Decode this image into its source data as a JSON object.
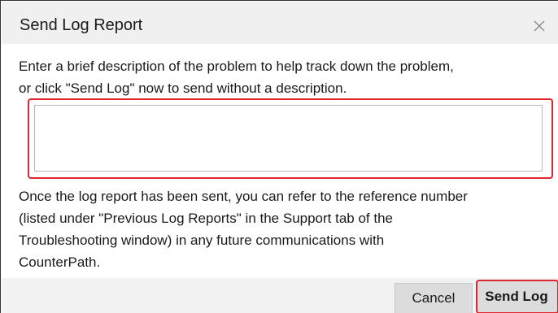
{
  "dialog": {
    "title": "Send Log Report",
    "close_icon": "close-icon",
    "intro_line1": "Enter a brief description of the problem to help track down the problem,",
    "intro_line2": "or click \"Send Log\" now to send without a description.",
    "description_input": {
      "value": "",
      "placeholder": ""
    },
    "info_line1": "Once the log report has been sent, you can refer to the reference number",
    "info_line2": "(listed under \"Previous Log Reports\" in the Support tab of the",
    "info_line3": "Troubleshooting window) in any future communications with",
    "info_line4": "CounterPath.",
    "buttons": {
      "cancel_label": "Cancel",
      "send_label": "Send Log"
    }
  },
  "colors": {
    "highlight": "#e0262e",
    "titlebar_bg": "#f0f0f0",
    "footer_bg": "#f2f2f2",
    "button_bg": "#dcdcdc"
  }
}
